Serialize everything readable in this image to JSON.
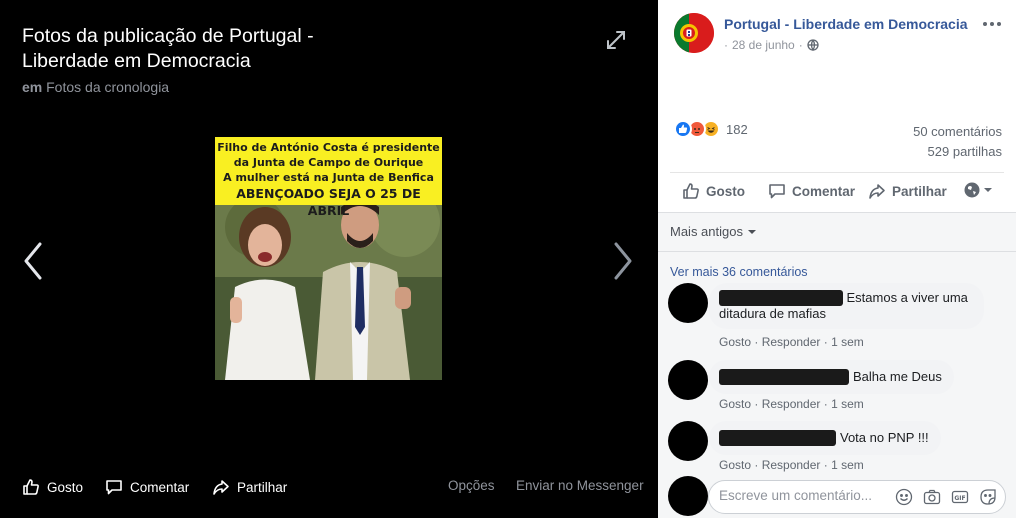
{
  "viewer": {
    "title": "Fotos da publicação de Portugal - Liberdade em Democracia",
    "sub_prefix": "em",
    "sub_link": "Fotos da cronologia",
    "image": {
      "banner_line1": "Filho de António Costa é presidente",
      "banner_line2": "da Junta de Campo de Ourique",
      "banner_line3": "A mulher está na Junta de Benfica",
      "banner_line4": "ABENÇOADO SEJA O 25 DE ABRIL"
    },
    "actions": {
      "like": "Gosto",
      "comment": "Comentar",
      "share": "Partilhar",
      "options": "Opções",
      "messenger": "Enviar no Messenger"
    }
  },
  "post": {
    "page_name": "Portugal - Liberdade em Democracia",
    "date": "28 de junho",
    "reactions_count": "182",
    "comments_count": "50 comentários",
    "shares_count": "529 partilhas",
    "actions": {
      "like": "Gosto",
      "comment": "Comentar",
      "share": "Partilhar"
    }
  },
  "comments": {
    "older_label": "Mais antigos",
    "see_more": "Ver mais 36 comentários",
    "items": [
      {
        "text_line1": "Estamos a viver uma",
        "text_line2": "ditadura de mafias",
        "like": "Gosto",
        "reply": "Responder",
        "time": "1 sem"
      },
      {
        "text_line1": "Balha me Deus",
        "like": "Gosto",
        "reply": "Responder",
        "time": "1 sem"
      },
      {
        "text_line1": "Vota no PNP !!!",
        "like": "Gosto",
        "reply": "Responder",
        "time": "1 sem"
      }
    ],
    "write_placeholder": "Escreve um comentário..."
  },
  "colors": {
    "link_blue": "#365899",
    "like_blue": "#1877f2",
    "angry_orange": "#f0593b",
    "haha_yellow": "#f7b125",
    "banner_yellow": "#f9ef22"
  },
  "icons": [
    "expand-icon",
    "chevron-left-icon",
    "chevron-right-icon",
    "thumbs-up-icon",
    "comment-icon",
    "share-icon",
    "globe-icon",
    "emoji-icon",
    "camera-icon",
    "gif-icon",
    "sticker-icon",
    "caret-down-icon"
  ]
}
